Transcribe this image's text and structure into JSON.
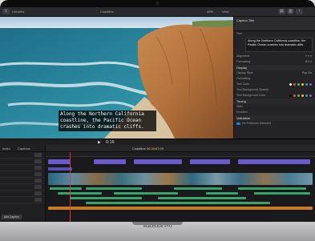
{
  "device": {
    "label": "MacBook Pro"
  },
  "topbar": {
    "library_label": "Libraries",
    "project_name": "Coastline",
    "zoom": "48%",
    "view_label": "View"
  },
  "viewer": {
    "caption_lines": [
      "Along the Northern California",
      "coastline, the Pacific Ocean",
      "crashes into dramatic cliffs."
    ]
  },
  "transport": {
    "timecode": "0:16"
  },
  "inspector": {
    "title": "Caption Title",
    "text_label": "Text",
    "text_value": "Along the Northern California coastline, the Pacific Ocean crashes into dramatic cliffs.",
    "rows": [
      {
        "label": "Alignment",
        "value": ""
      },
      {
        "label": "Formatting",
        "value": ""
      },
      {
        "label": "Display",
        "value": ""
      },
      {
        "label": "Display Style",
        "value": "Pop On"
      },
      {
        "label": "Formatting",
        "value": ""
      },
      {
        "label": "Text Color",
        "value": ""
      },
      {
        "label": "Text Background Opacity",
        "value": ""
      },
      {
        "label": "Text Background Color",
        "value": ""
      },
      {
        "label": "Timing",
        "value": ""
      },
      {
        "label": "Start",
        "value": ""
      },
      {
        "label": "Duration",
        "value": ""
      },
      {
        "label": "Validation",
        "value": ""
      }
    ],
    "footer": "No Problems Detected"
  },
  "browser": {
    "tab_label": "Captions",
    "rows": [
      "",
      "",
      "",
      "",
      "",
      "",
      "",
      ""
    ],
    "button_label": "Add Caption"
  },
  "timeline": {
    "index_label": "Index",
    "title": "Coastline",
    "duration": "00:00:57:09"
  },
  "colors": {
    "accent": "#3a7bd5",
    "caption_lane": "#6a5acd",
    "audio_green": "#3aa36a",
    "music_orange": "#c77a2e",
    "playhead": "#e03b3b"
  }
}
